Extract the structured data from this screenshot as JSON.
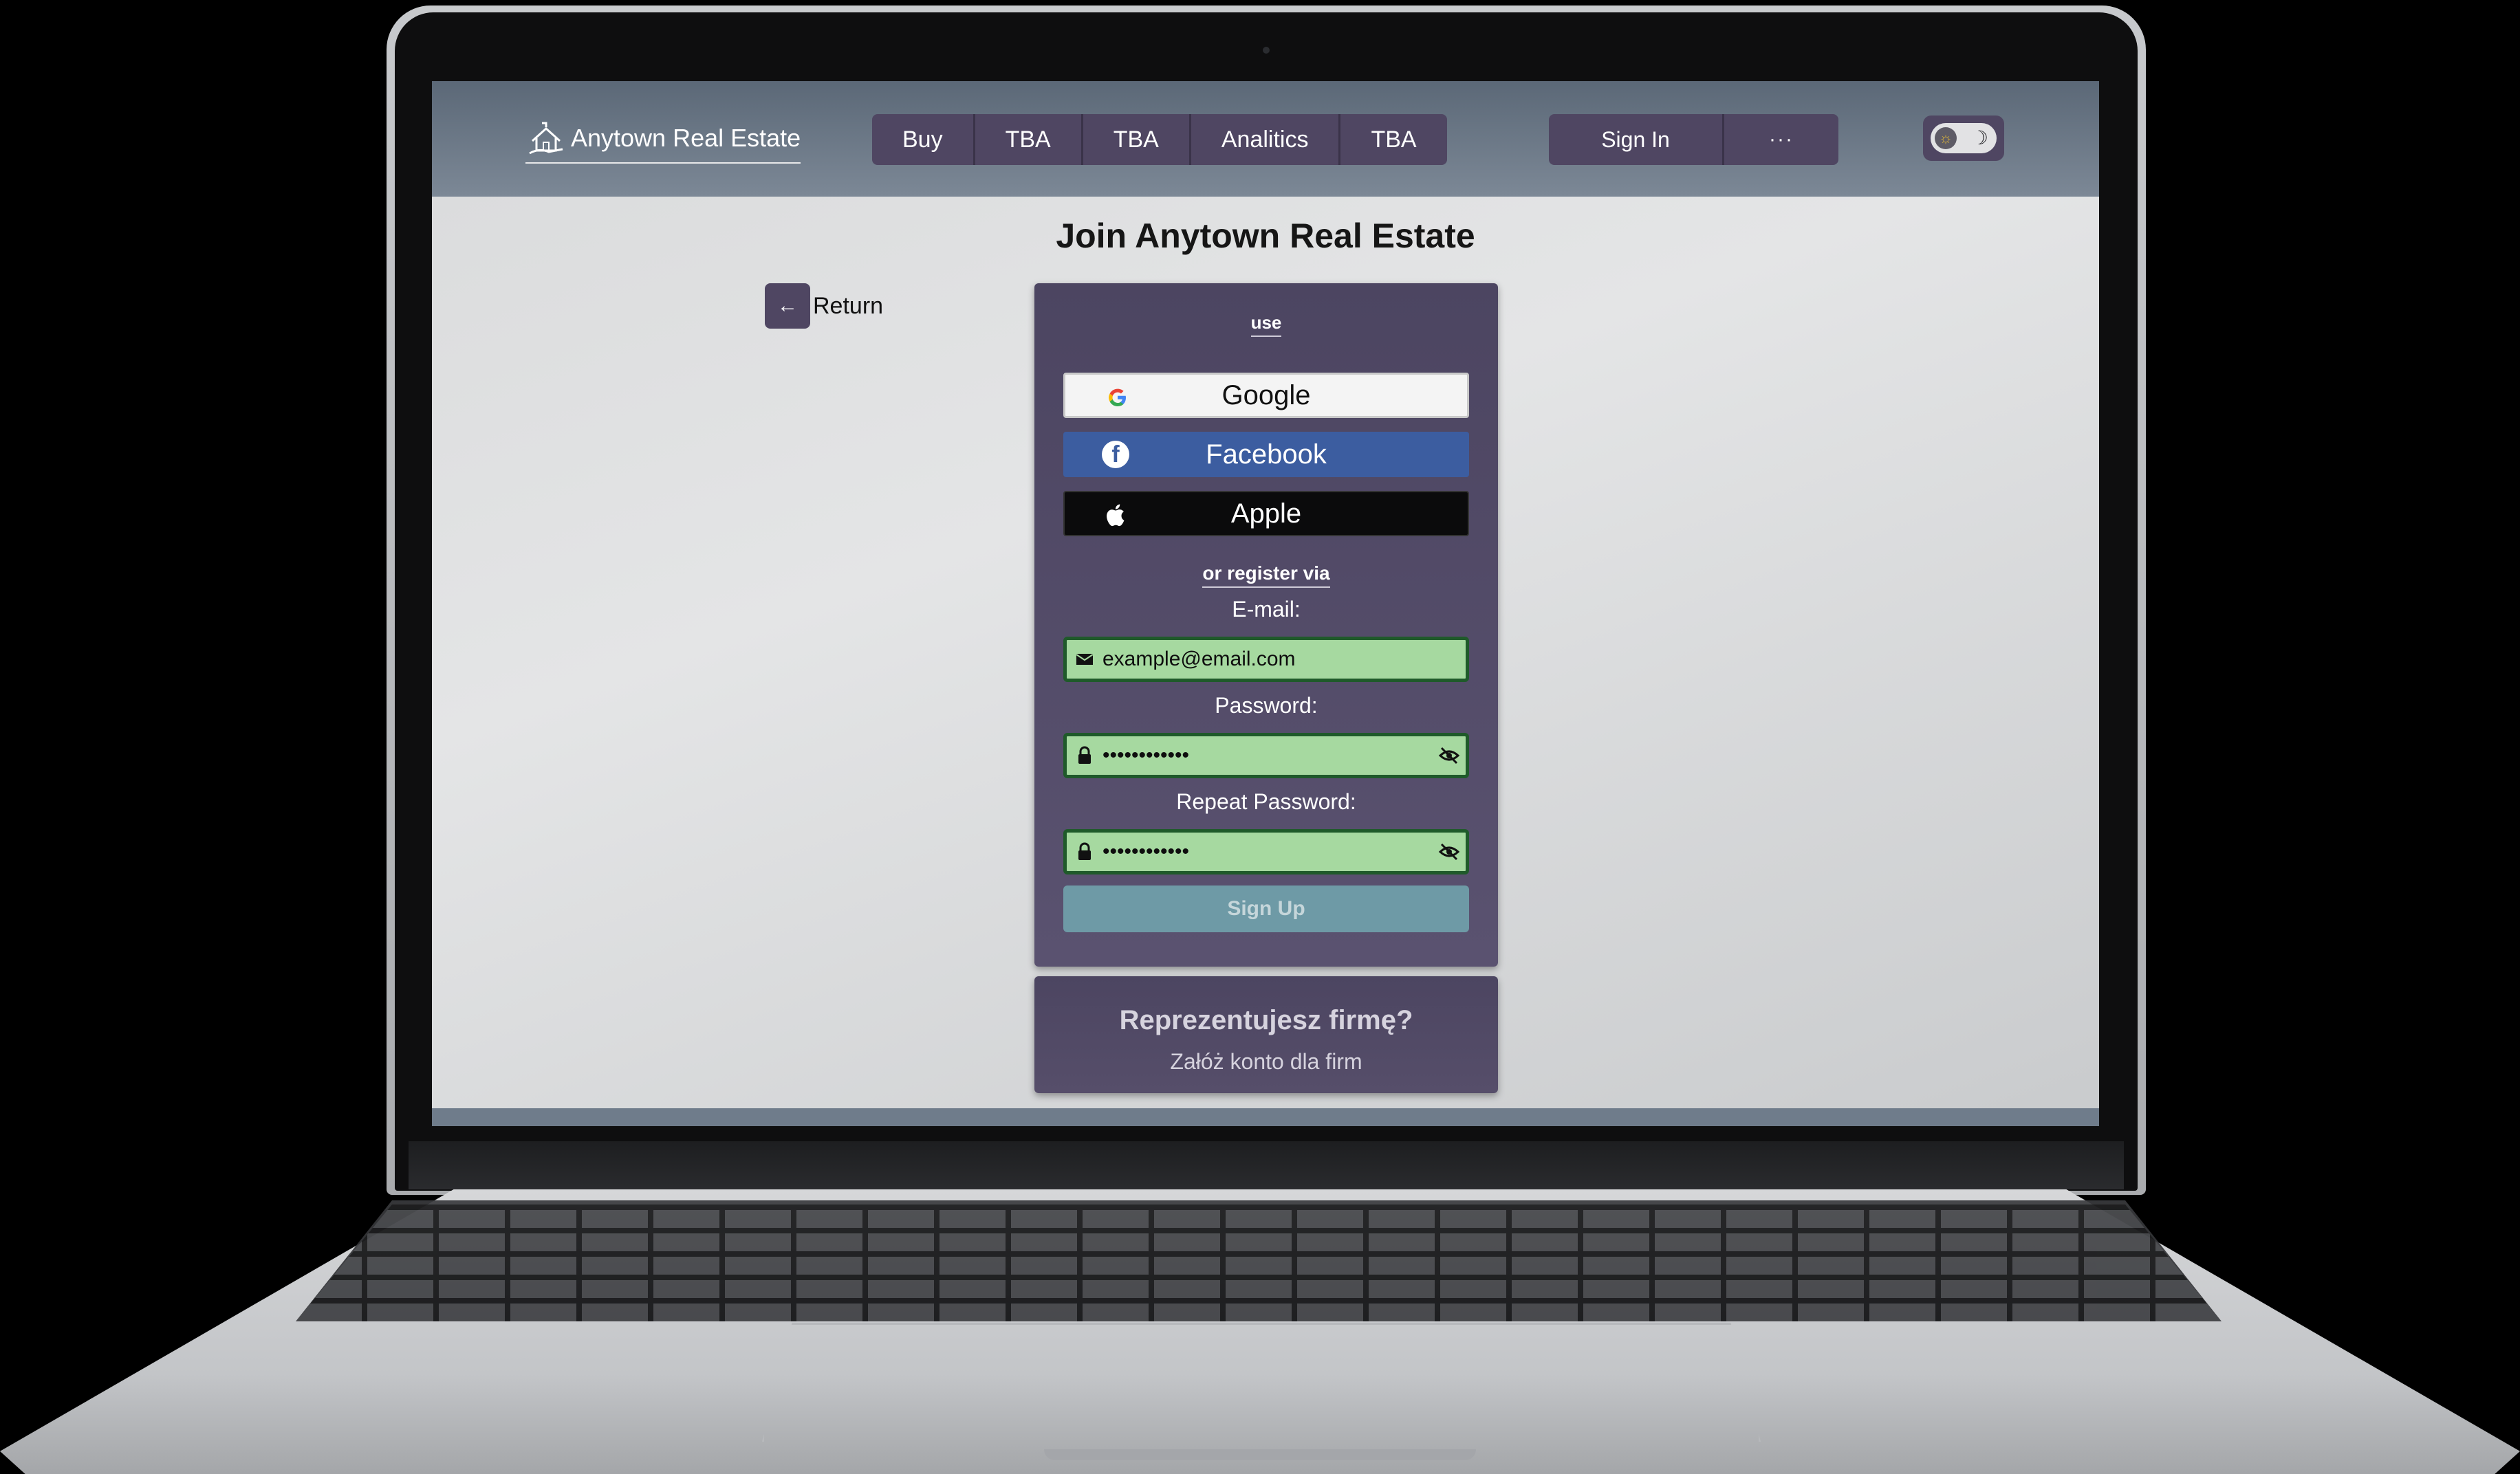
{
  "header": {
    "logo_text": "Anytown Real Estate",
    "nav": [
      "Buy",
      "TBA",
      "TBA",
      "Analitics",
      "TBA"
    ],
    "sign_in": "Sign In",
    "more": "···",
    "theme_toggle": {
      "state": "light",
      "icons": [
        "sun-icon",
        "moon-icon"
      ]
    }
  },
  "page": {
    "title": "Join Anytown Real Estate",
    "return_label": "Return"
  },
  "form": {
    "use_label": "use",
    "social": {
      "google": "Google",
      "facebook": "Facebook",
      "apple": "Apple"
    },
    "or_register": "or register via",
    "email_label": "E-mail:",
    "email_value": "example@email.com",
    "password_label": "Password:",
    "password_value": "••••••••••••",
    "repeat_label": "Repeat Password:",
    "repeat_value": "••••••••••••",
    "signup_label": "Sign Up",
    "field_state_color": "#a6d9a0"
  },
  "company": {
    "title": "Reprezentujesz firmę?",
    "subtitle": "Załóż konto dla firm"
  },
  "colors": {
    "accent": "#4f4662",
    "header": "#6b7786",
    "facebook": "#3c5da0",
    "signup": "#6e9aa6"
  }
}
